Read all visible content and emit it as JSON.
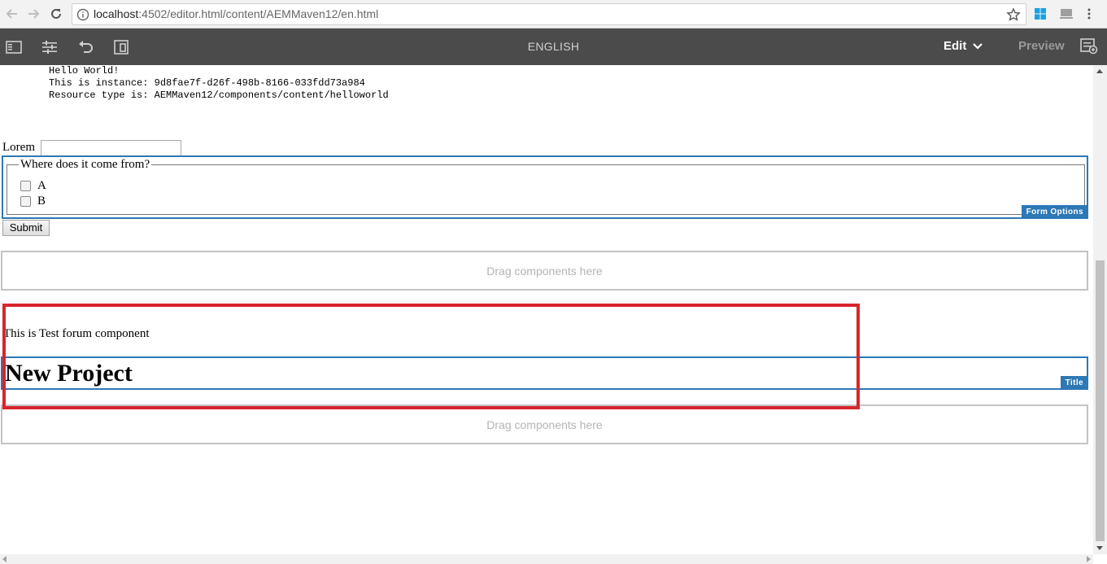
{
  "browser": {
    "url_host": "localhost",
    "url_path": ":4502/editor.html/content/AEMMaven12/en.html",
    "icons": [
      "back-icon",
      "forward-icon",
      "reload-icon",
      "info-icon",
      "star-icon",
      "windows-extension-icon",
      "extension-icon"
    ]
  },
  "toolbar": {
    "language": "ENGLISH",
    "edit_label": "Edit",
    "preview_label": "Preview",
    "icons": [
      "side-panel-icon",
      "properties-icon",
      "undo-icon",
      "emulator-icon",
      "chevron-down-icon",
      "annotation-icon"
    ]
  },
  "hello": {
    "line1": "Hello World!",
    "line2": "This is instance: 9d8fae7f-d26f-498b-8166-033fdd73a984",
    "line3": "Resource type is: AEMMaven12/components/content/helloworld"
  },
  "form": {
    "lorem_label": "Lorem",
    "lorem_value": "",
    "question": "Where does it come from?",
    "option_a": "A",
    "option_b": "B",
    "badge": "Form Options",
    "submit_label": "Submit"
  },
  "dropzone": {
    "label": "Drag components here"
  },
  "forum": {
    "text": "This is Test forum component"
  },
  "title_component": {
    "text": "New Project",
    "badge": "Title"
  },
  "colors": {
    "toolbar_bg": "#4b4b4b",
    "accent_blue": "#2d78b5",
    "highlight_red": "#d9252c"
  }
}
